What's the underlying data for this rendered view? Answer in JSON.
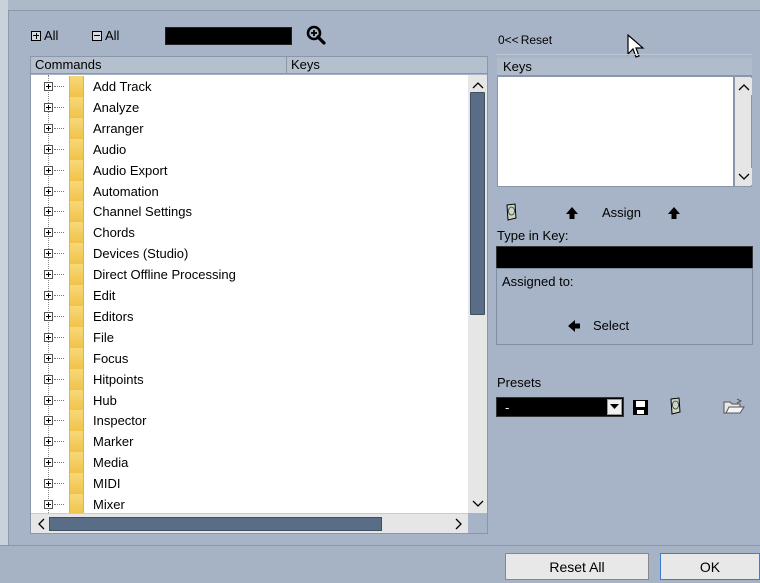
{
  "toolbar": {
    "expand_all_label": "All",
    "collapse_all_label": "All",
    "search_value": ""
  },
  "columns": {
    "commands": "Commands",
    "keys": "Keys"
  },
  "tree_items": [
    "Add Track",
    "Analyze",
    "Arranger",
    "Audio",
    "Audio Export",
    "Automation",
    "Channel Settings",
    "Chords",
    "Devices (Studio)",
    "Direct Offline Processing",
    "Edit",
    "Editors",
    "File",
    "Focus",
    "Hitpoints",
    "Hub",
    "Inspector",
    "Marker",
    "Media",
    "MIDI",
    "Mixer"
  ],
  "right_panel": {
    "reset_label": "Reset",
    "reset_prefix": "0<<",
    "keys_header": "Keys",
    "assign_label": "Assign",
    "type_in_key_label": "Type in Key:",
    "type_in_key_value": "",
    "assigned_to_label": "Assigned to:",
    "select_label": "Select",
    "presets_label": "Presets",
    "preset_value": "-"
  },
  "footer": {
    "reset_all_label": "Reset All",
    "ok_label": "OK"
  }
}
